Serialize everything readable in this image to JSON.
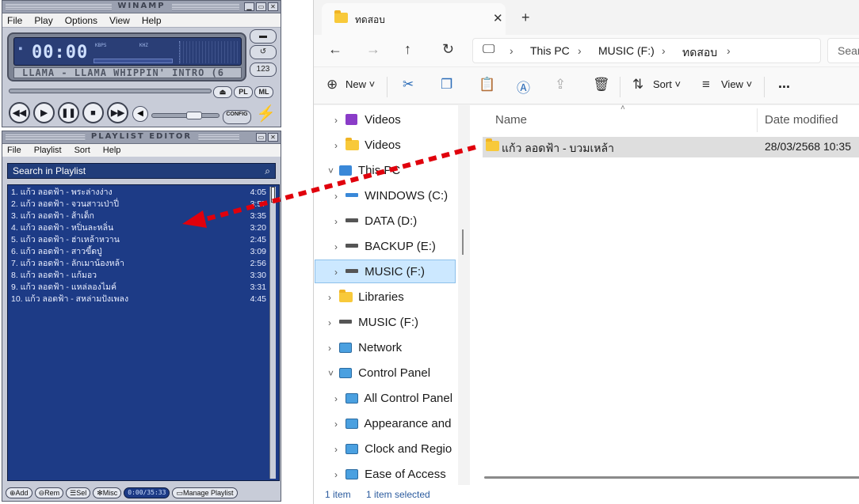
{
  "winamp": {
    "title": "WINAMP",
    "menu": [
      "File",
      "Play",
      "Options",
      "View",
      "Help"
    ],
    "time": "00:00",
    "kbps_label": "KBPS",
    "khz_label": "KHZ",
    "scroll_text": "LLAMA - LLAMA WHIPPIN' INTRO (6",
    "pl_button": "PL",
    "ml_button": "ML",
    "config_label": "CONFIG"
  },
  "playlist": {
    "title": "PLAYLIST EDITOR",
    "menu": [
      "File",
      "Playlist",
      "Sort",
      "Help"
    ],
    "search_placeholder": "Search in Playlist",
    "items": [
      {
        "title": "1. แก้ว ลอดฟ้า - พระล่างง่าง",
        "duration": "4:05"
      },
      {
        "title": "2. แก้ว ลอดฟ้า - จวนสาวเป่าปี่",
        "duration": "3:57"
      },
      {
        "title": "3. แก้ว ลอดฟ้า - ส้าเด็ก",
        "duration": "3:35"
      },
      {
        "title": "4. แก้ว ลอดฟ้า - หปิ่นละหลิ่น",
        "duration": "3:20"
      },
      {
        "title": "5. แก้ว ลอดฟ้า - ฮ่าเหล้าหวาน",
        "duration": "2:45"
      },
      {
        "title": "6. แก้ว ลอดฟ้า - สาวขี้ดปู่",
        "duration": "3:09"
      },
      {
        "title": "7. แก้ว ลอดฟ้า - ลักเมาน้องหล้า",
        "duration": "2:56"
      },
      {
        "title": "8. แก้ว ลอดฟ้า - แก้มอว",
        "duration": "3:30"
      },
      {
        "title": "9. แก้ว ลอดฟ้า - แหล่ลองไมค์",
        "duration": "3:31"
      },
      {
        "title": "10. แก้ว ลอดฟ้า - สหล่ามปังเพลง",
        "duration": "4:45"
      }
    ],
    "buttons": {
      "add": "Add",
      "rem": "Rem",
      "sel": "Sel",
      "misc": "Misc",
      "manage": "Manage Playlist"
    },
    "total_time": "0:00/35:33"
  },
  "explorer": {
    "tab_title": "ทดสอบ",
    "breadcrumb": [
      "This PC",
      "MUSIC (F:)",
      "ทดสอบ"
    ],
    "search_placeholder": "Sear",
    "commands": {
      "new": "New",
      "sort": "Sort",
      "view": "View",
      "more": "..."
    },
    "nav": [
      {
        "label": "Videos",
        "icon": "video-icon",
        "indent": 1
      },
      {
        "label": "Videos",
        "icon": "folder-icon",
        "indent": 1
      },
      {
        "label": "This PC",
        "icon": "pc-icon",
        "indent": 0,
        "expanded": true
      },
      {
        "label": "WINDOWS (C:)",
        "icon": "windows-drive-icon",
        "indent": 1
      },
      {
        "label": "DATA (D:)",
        "icon": "drive-icon",
        "indent": 1
      },
      {
        "label": "BACKUP (E:)",
        "icon": "drive-icon",
        "indent": 1
      },
      {
        "label": "MUSIC (F:)",
        "icon": "drive-icon",
        "indent": 1,
        "selected": true
      },
      {
        "label": "Libraries",
        "icon": "folder-icon",
        "indent": 0
      },
      {
        "label": "MUSIC (F:)",
        "icon": "drive-icon",
        "indent": 0
      },
      {
        "label": "Network",
        "icon": "network-icon",
        "indent": 0
      },
      {
        "label": "Control Panel",
        "icon": "control-panel-icon",
        "indent": 0,
        "expanded": true
      },
      {
        "label": "All Control Panel",
        "icon": "control-panel-icon",
        "indent": 1
      },
      {
        "label": "Appearance and",
        "icon": "control-panel-icon",
        "indent": 1
      },
      {
        "label": "Clock and Regio",
        "icon": "control-panel-icon",
        "indent": 1
      },
      {
        "label": "Ease of Access",
        "icon": "control-panel-icon",
        "indent": 1
      }
    ],
    "columns": {
      "name": "Name",
      "date": "Date modified"
    },
    "files": [
      {
        "name": "แก้ว ลอดฟ้า - บวมเหล้า",
        "date": "28/03/2568 10:35"
      }
    ],
    "status": {
      "count": "1 item",
      "selected": "1 item selected"
    }
  },
  "colors": {
    "arrow": "#e0000c",
    "playlist_bg": "#1d3b86",
    "selection": "#cce8ff"
  }
}
